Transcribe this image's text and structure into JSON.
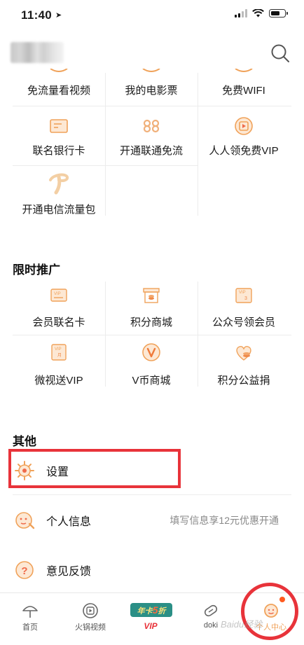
{
  "status_bar": {
    "time": "11:40"
  },
  "services_grid": [
    {
      "label": "免流量看视频",
      "icon": "partial-icon"
    },
    {
      "label": "我的电影票",
      "icon": "partial-icon"
    },
    {
      "label": "免费WIFI",
      "icon": "partial-icon"
    },
    {
      "label": "联名银行卡",
      "icon": "bank-card-icon"
    },
    {
      "label": "开通联通免流",
      "icon": "china-unicom-icon"
    },
    {
      "label": "人人领免费VIP",
      "icon": "film-vip-icon"
    },
    {
      "label": "开通电信流量包",
      "icon": "china-telecom-icon"
    }
  ],
  "promo": {
    "title": "限时推广",
    "items": [
      {
        "label": "会员联名卡",
        "icon": "vip-card-icon"
      },
      {
        "label": "积分商城",
        "icon": "points-shop-icon"
      },
      {
        "label": "公众号领会员",
        "icon": "vip-ticket-icon"
      },
      {
        "label": "微视送VIP",
        "icon": "vip-month-card-icon"
      },
      {
        "label": "V币商城",
        "icon": "v-coin-icon"
      },
      {
        "label": "积分公益捐",
        "icon": "charity-heart-icon"
      }
    ]
  },
  "other": {
    "title": "其他",
    "items": [
      {
        "label": "设置",
        "hint": "",
        "icon": "gear-icon"
      },
      {
        "label": "个人信息",
        "hint": "填写信息享12元优惠开通",
        "icon": "profile-face-icon"
      },
      {
        "label": "意见反馈",
        "hint": "",
        "icon": "question-icon"
      }
    ]
  },
  "tabbar": {
    "tabs": [
      {
        "label": "首页",
        "icon": "umbrella-icon"
      },
      {
        "label": "火锅视频",
        "icon": "play-icon"
      },
      {
        "label": "VIP",
        "badge_prefix": "年卡",
        "badge_num": "5",
        "badge_suffix": "折"
      },
      {
        "label": "doki",
        "icon": "doki-icon"
      },
      {
        "label": "个人中心",
        "icon": "profile-center-icon"
      }
    ]
  },
  "watermark": "Baidu经验",
  "colors": {
    "accent": "#f0a25a",
    "highlight": "#e8333a",
    "vip_label": "#e8333a"
  }
}
